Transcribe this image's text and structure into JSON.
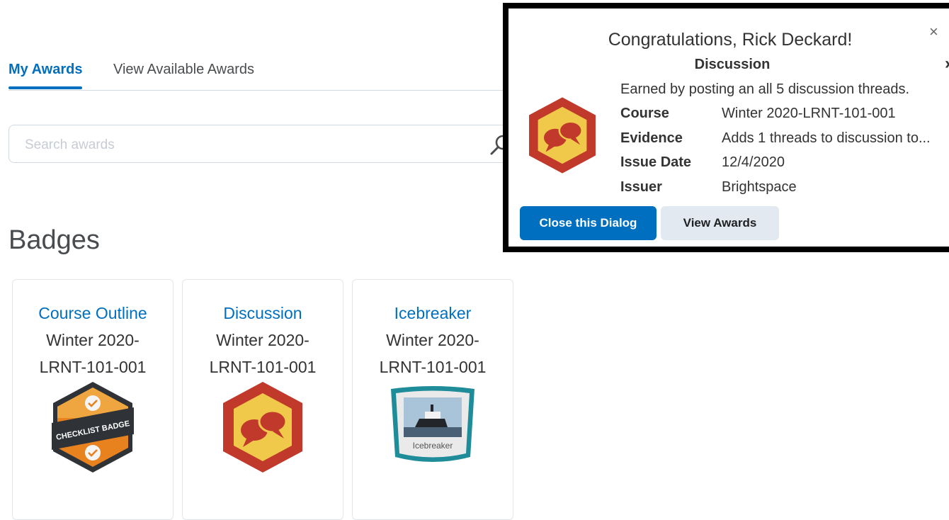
{
  "tabs": {
    "my_awards": "My Awards",
    "view_available": "View Available Awards"
  },
  "search": {
    "placeholder": "Search awards",
    "value": ""
  },
  "badges_heading": "Badges",
  "cards": [
    {
      "title": "Course Outline",
      "course": "Winter 2020-LRNT-101-001",
      "badge_icon": "checklist-badge-icon",
      "badge_text": "CHECKLIST BADGE"
    },
    {
      "title": "Discussion",
      "course": "Winter 2020-LRNT-101-001",
      "badge_icon": "discussion-badge-icon"
    },
    {
      "title": "Icebreaker",
      "course": "Winter 2020-LRNT-101-001",
      "badge_icon": "icebreaker-badge-icon",
      "badge_text": "Icebreaker"
    }
  ],
  "dialog": {
    "title": "Congratulations, Rick Deckard!",
    "award_name": "Discussion",
    "description": "Earned by posting an all 5 discussion threads.",
    "rows": [
      {
        "label": "Course",
        "value": "Winter 2020-LRNT-101-001"
      },
      {
        "label": "Evidence",
        "value": "Adds 1 threads to discussion to..."
      },
      {
        "label": "Issue Date",
        "value": "12/4/2020"
      },
      {
        "label": "Issuer",
        "value": "Brightspace"
      }
    ],
    "close_symbol": "×",
    "next_symbol": "›",
    "primary_button": "Close this Dialog",
    "secondary_button": "View Awards"
  },
  "colors": {
    "accent": "#006fbf",
    "badge_red": "#c0392b",
    "badge_yellow": "#f1c94a",
    "badge_orange": "#e8821e",
    "badge_teal": "#1e8c99"
  }
}
